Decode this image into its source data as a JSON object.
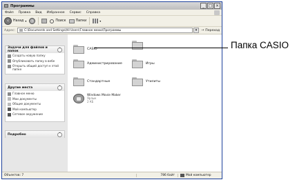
{
  "window": {
    "title": "Программы",
    "buttons": [
      "_",
      "□",
      "×"
    ]
  },
  "menu": [
    "Файл",
    "Правка",
    "Вид",
    "Избранное",
    "Сервис",
    "Справка"
  ],
  "toolbar": {
    "back": "Назад",
    "search": "Поиск",
    "folders": "Папки"
  },
  "address": {
    "label": "Адрес:",
    "path": "C:\\Documents and Settings\\All Users\\Главное меню\\Программы",
    "go": "Переход"
  },
  "tasks_panel": {
    "title": "Задачи для файлов и папок",
    "items": [
      "Создать новую папку",
      "Опубликовать папку в вебе",
      "Открыть общий доступ к этой папке"
    ]
  },
  "places_panel": {
    "title": "Другие места",
    "items": [
      "Главное меню",
      "Мои документы",
      "Общие документы",
      "Мой компьютер",
      "Сетевое окружение"
    ]
  },
  "details_panel": {
    "title": "Подробно"
  },
  "files": [
    {
      "name": "CASIO",
      "kind": "folder"
    },
    {
      "name": "",
      "kind": "folder"
    },
    {
      "name": "Администрирование",
      "kind": "folder"
    },
    {
      "name": "Игры",
      "kind": "folder"
    },
    {
      "name": "Стандартные",
      "kind": "folder"
    },
    {
      "name": "Утилиты",
      "kind": "folder"
    },
    {
      "name": "Windows Movie Maker",
      "kind": "shortcut",
      "sub1": "Ярлык",
      "sub2": "2 КБ"
    }
  ],
  "status": {
    "objects": "Объектов: 7",
    "size": "786 байт",
    "location": "Мой компьютер"
  },
  "callout": {
    "text": "Папка CASIO"
  }
}
